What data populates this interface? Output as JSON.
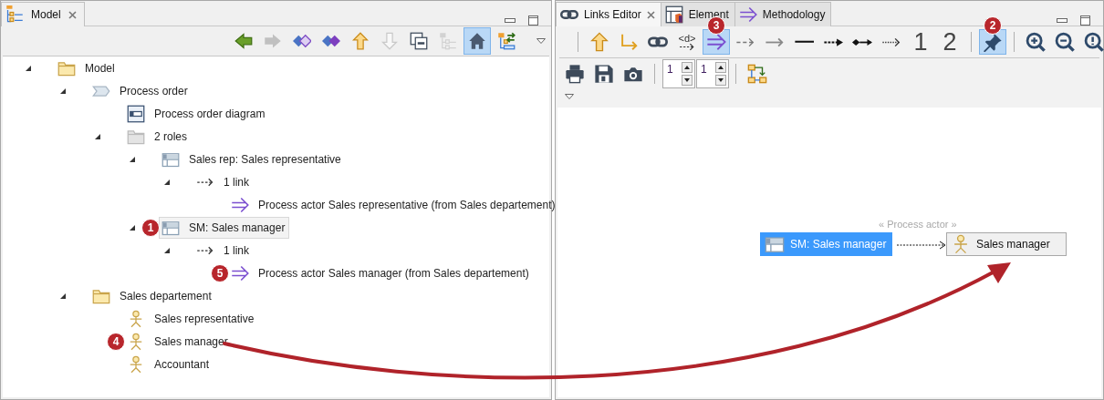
{
  "model_view": {
    "tab": {
      "label": "Model",
      "selected": true
    },
    "toolbar": [
      {
        "kind": "back",
        "selected": false,
        "disabled": false
      },
      {
        "kind": "forward",
        "selected": false,
        "disabled": true
      },
      {
        "kind": "diamond-outline",
        "selected": false,
        "disabled": false
      },
      {
        "kind": "diamond-filled",
        "selected": false,
        "disabled": false
      },
      {
        "kind": "up",
        "selected": false,
        "disabled": false
      },
      {
        "kind": "down",
        "selected": false,
        "disabled": true
      },
      {
        "kind": "collapse",
        "selected": false,
        "disabled": false
      },
      {
        "kind": "tree",
        "selected": false,
        "disabled": true
      },
      {
        "kind": "home",
        "selected": true,
        "disabled": false
      },
      {
        "kind": "sync",
        "selected": false,
        "disabled": false
      }
    ],
    "tree": [
      {
        "kind": "folder",
        "label": "Model",
        "selected": false,
        "expanded": true,
        "children": [
          {
            "kind": "process",
            "label": "Process order",
            "selected": false,
            "expanded": true,
            "children": [
              {
                "kind": "diagram",
                "label": "Process order diagram",
                "selected": false
              },
              {
                "kind": "group",
                "label": "2 roles",
                "selected": false,
                "expanded": true,
                "children": [
                  {
                    "kind": "role",
                    "label": "Sales rep: Sales representative",
                    "selected": false,
                    "expanded": true,
                    "children": [
                      {
                        "kind": "dependency",
                        "label": "1 link",
                        "selected": false,
                        "expanded": true,
                        "children": [
                          {
                            "kind": "link",
                            "label": "Process actor Sales representative (from Sales departement)",
                            "selected": false
                          }
                        ]
                      }
                    ]
                  },
                  {
                    "kind": "role",
                    "label": "SM: Sales manager",
                    "selected": true,
                    "callout": "1",
                    "expanded": true,
                    "children": [
                      {
                        "kind": "dependency",
                        "label": "1 link",
                        "selected": false,
                        "expanded": true,
                        "children": [
                          {
                            "kind": "link",
                            "label": "Process actor Sales manager (from Sales departement)",
                            "selected": false,
                            "callout": "5"
                          }
                        ]
                      }
                    ]
                  }
                ]
              }
            ]
          },
          {
            "kind": "folder",
            "label": "Sales departement",
            "selected": false,
            "expanded": true,
            "children": [
              {
                "kind": "actor",
                "label": "Sales representative",
                "selected": false
              },
              {
                "kind": "actor",
                "label": "Sales manager",
                "selected": false,
                "callout": "4"
              },
              {
                "kind": "actor",
                "label": "Accountant",
                "selected": false
              }
            ]
          }
        ]
      }
    ]
  },
  "links_editor": {
    "tabs": [
      {
        "kind": "chain",
        "label": "Links Editor",
        "selected": true
      },
      {
        "kind": "element",
        "label": "Element",
        "selected": false
      },
      {
        "kind": "double",
        "label": "Methodology",
        "selected": false
      }
    ],
    "toolbar": [
      {
        "items": [
          {
            "kind": "up",
            "selected": false
          },
          {
            "kind": "hook",
            "selected": false
          },
          {
            "kind": "chain",
            "selected": false
          },
          {
            "kind": "dependency",
            "label": "<d>",
            "selected": false
          },
          {
            "kind": "double",
            "selected": true,
            "callout": "3"
          },
          {
            "kind": "dashed",
            "selected": false
          },
          {
            "kind": "grey-arrow",
            "selected": false
          },
          {
            "kind": "line",
            "selected": false
          },
          {
            "kind": "dotted-bold",
            "selected": false
          },
          {
            "kind": "diamond-line",
            "selected": false
          },
          {
            "kind": "dotted",
            "selected": false
          },
          {
            "kind": "number",
            "label": "1",
            "selected": false
          },
          {
            "kind": "number",
            "label": "2",
            "selected": false
          }
        ]
      },
      {
        "items": [
          {
            "kind": "pin",
            "selected": true,
            "callout": "2"
          }
        ]
      },
      {
        "items": [
          {
            "kind": "zoom-in",
            "selected": false
          },
          {
            "kind": "zoom-out",
            "selected": false
          },
          {
            "kind": "zoom-fit",
            "selected": false
          }
        ]
      }
    ],
    "actions": [
      {
        "kind": "print"
      },
      {
        "kind": "save"
      },
      {
        "kind": "camera"
      }
    ],
    "spinners": [
      {
        "value": "1"
      },
      {
        "value": "1"
      }
    ],
    "diagram": {
      "nodes": [
        {
          "kind": "role",
          "label": "SM: Sales manager",
          "selected": true
        },
        {
          "kind": "actor",
          "label": "Sales manager",
          "selected": false
        }
      ],
      "link": {
        "label": "« Process actor »"
      }
    }
  }
}
